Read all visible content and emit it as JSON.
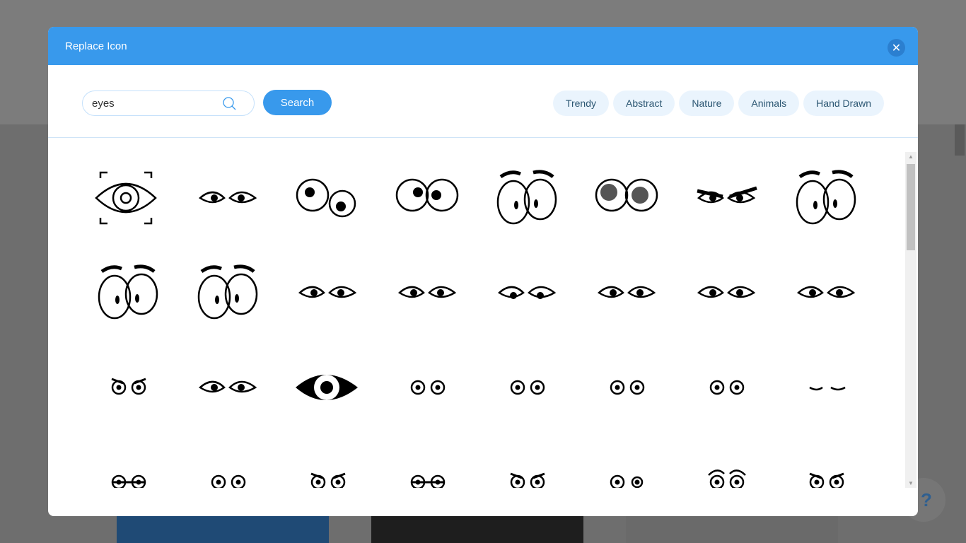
{
  "dialog": {
    "title": "Replace Icon",
    "close_icon": "close-icon"
  },
  "search": {
    "value": "eyes",
    "button": "Search",
    "icon": "search-icon"
  },
  "tags": [
    "Trendy",
    "Abstract",
    "Nature",
    "Animals",
    "Hand Drawn"
  ],
  "help": {
    "label": "?"
  },
  "colors": {
    "accent": "#3899ec",
    "tag_bg": "#eaf4fd",
    "overlay": "#6e6e6e"
  },
  "icons": [
    "eye-scan",
    "cat-eyes",
    "googly-eyes-uneven",
    "round-eyes",
    "tall-eyes-brows",
    "realistic-iris-eyes",
    "angry-eyes",
    "cartoon-eyes-brows",
    "cartoon-eyes-brows-2",
    "surprised-eyes",
    "almond-eyes",
    "almond-eyes",
    "almond-eyes-down",
    "almond-eyes",
    "almond-eyes",
    "almond-eyes",
    "grumpy-eyes",
    "lash-eyes",
    "big-eye",
    "ring-eyes",
    "ring-eyes-up",
    "ring-eyes-side",
    "ring-eyes-lids",
    "closed-eyes",
    "sleepy-eyes",
    "dot-eyes",
    "angry-small-eyes",
    "banded-eyes",
    "sad-brow-eyes",
    "uneven-dot-eyes",
    "arched-brow-eyes",
    "angry-small-eyes"
  ]
}
